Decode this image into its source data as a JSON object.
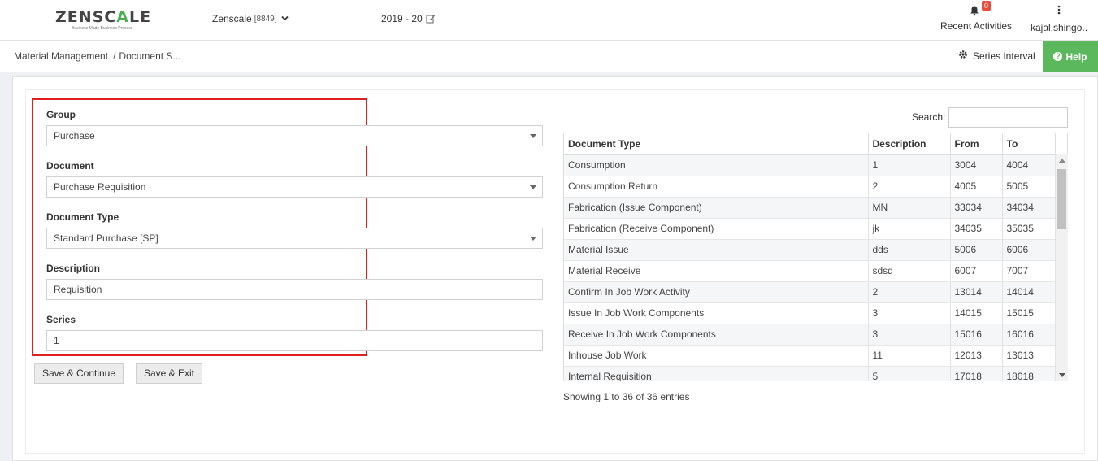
{
  "header": {
    "logo": {
      "prefix": "ZENSC",
      "accent": "A",
      "suffix": "LE",
      "tagline": "Business Made Business Process"
    },
    "company": {
      "name": "Zenscale",
      "code": "[8849]"
    },
    "year": "2019 - 20",
    "recent": {
      "badge": "0",
      "label": "Recent Activities"
    },
    "user": {
      "name": "kajal.shingo.."
    }
  },
  "breadcrumb": {
    "root": "Material Management",
    "separator": "/",
    "current": "Document S..."
  },
  "series_interval": {
    "label": "Series Interval"
  },
  "help": {
    "label": "Help"
  },
  "form": {
    "group": {
      "label": "Group",
      "value": "Purchase"
    },
    "document": {
      "label": "Document",
      "value": "Purchase Requisition"
    },
    "document_type": {
      "label": "Document Type",
      "value": "Standard Purchase [SP]"
    },
    "description": {
      "label": "Description",
      "value": "Requisition"
    },
    "series": {
      "label": "Series",
      "value": "1"
    },
    "save_continue": "Save & Continue",
    "save_exit": "Save & Exit"
  },
  "table": {
    "search_label": "Search:",
    "columns": [
      "Document Type",
      "Description",
      "From",
      "To"
    ],
    "rows": [
      [
        "Consumption",
        "1",
        "3004",
        "4004"
      ],
      [
        "Consumption Return",
        "2",
        "4005",
        "5005"
      ],
      [
        "Fabrication (Issue Component)",
        "MN",
        "33034",
        "34034"
      ],
      [
        "Fabrication (Receive Component)",
        "jk",
        "34035",
        "35035"
      ],
      [
        "Material Issue",
        "dds",
        "5006",
        "6006"
      ],
      [
        "Material Receive",
        "sdsd",
        "6007",
        "7007"
      ],
      [
        "Confirm In Job Work Activity",
        "2",
        "13014",
        "14014"
      ],
      [
        "Issue In Job Work Components",
        "3",
        "14015",
        "15015"
      ],
      [
        "Receive In Job Work Components",
        "3",
        "15016",
        "16016"
      ],
      [
        "Inhouse Job Work",
        "11",
        "12013",
        "13013"
      ],
      [
        "Internal Requisition",
        "5",
        "17018",
        "18018"
      ]
    ],
    "info": "Showing 1 to 36 of 36 entries"
  },
  "colors": {
    "accent_green": "#5cb85c",
    "highlight_red": "#e02020",
    "badge_red": "#e74c3c"
  },
  "icons": {
    "bell": "bell-icon",
    "more": "vertical-dots-icon",
    "gear": "gear-icon",
    "help": "question-circle-icon",
    "edit": "edit-icon",
    "chevron": "chevron-down-icon"
  }
}
